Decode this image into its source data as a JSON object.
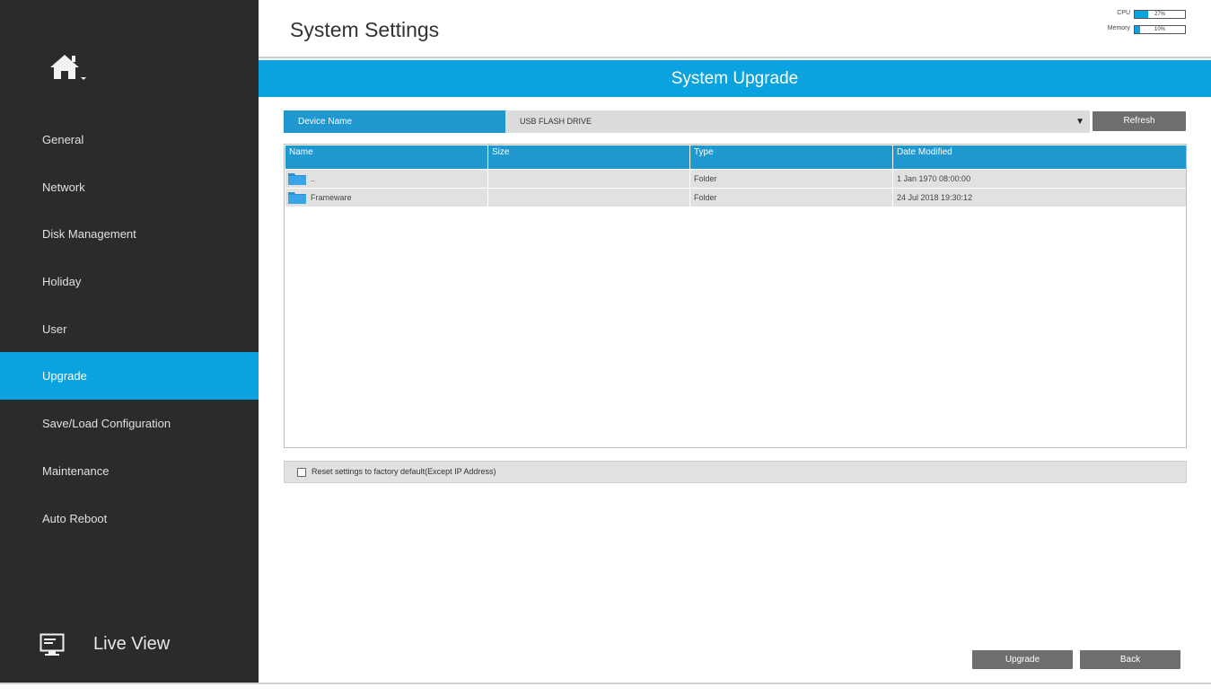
{
  "sidebar": {
    "items": [
      {
        "label": "General",
        "active": false
      },
      {
        "label": "Network",
        "active": false
      },
      {
        "label": "Disk Management",
        "active": false
      },
      {
        "label": "Holiday",
        "active": false
      },
      {
        "label": "User",
        "active": false
      },
      {
        "label": "Upgrade",
        "active": true
      },
      {
        "label": "Save/Load Configuration",
        "active": false
      },
      {
        "label": "Maintenance",
        "active": false
      },
      {
        "label": "Auto Reboot",
        "active": false
      }
    ],
    "live_view_label": "Live View",
    "home_icon": "home-icon",
    "monitor_icon": "monitor-icon"
  },
  "header": {
    "title": "System Settings",
    "cpu": {
      "label": "CPU",
      "value_text": "27%",
      "fraction": 0.27
    },
    "memory": {
      "label": "Memory",
      "value_text": "10%",
      "fraction": 0.1
    }
  },
  "section_title": "System Upgrade",
  "device": {
    "label": "Device Name",
    "selected": "USB FLASH DRIVE",
    "refresh_label": "Refresh"
  },
  "table": {
    "columns": [
      "Name",
      "Size",
      "Type",
      "Date Modified"
    ],
    "rows": [
      {
        "name": "..",
        "size": "",
        "type": "Folder",
        "date": "1 Jan 1970 08:00:00"
      },
      {
        "name": "Frameware",
        "size": "",
        "type": "Folder",
        "date": "24 Jul 2018 19:30:12"
      }
    ]
  },
  "reset": {
    "label": "Reset settings to factory default(Except IP Address)",
    "checked": false
  },
  "buttons": {
    "upgrade": "Upgrade",
    "back": "Back"
  },
  "colors": {
    "accent": "#0aa3e0",
    "table_header": "#1f97cf",
    "sidebar": "#2b2b2b",
    "button": "#6e6e6e"
  }
}
